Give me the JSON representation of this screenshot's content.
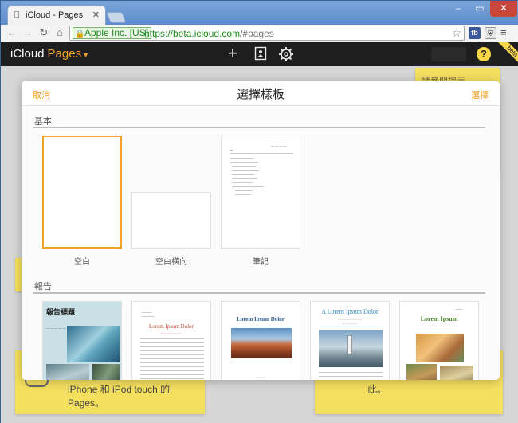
{
  "browser": {
    "tab_title": "iCloud - Pages",
    "ev_label": "Apple Inc. [US]",
    "url_scheme_host": "https://beta.icloud.com",
    "url_path": "/#pages"
  },
  "app": {
    "brand": "iCloud",
    "app_name": "Pages",
    "beta_label": "beta"
  },
  "background": {
    "note_top_right": "請參閱提示",
    "note_bottom_left": "iPhone 和 iPod touch 的 Pages。",
    "note_bottom_right": "此。"
  },
  "dialog": {
    "cancel": "取消",
    "title": "選擇樣板",
    "choose": "選擇",
    "sections": [
      {
        "title": "基本",
        "templates": [
          {
            "name": "空白",
            "selected": true
          },
          {
            "name": "空白橫向",
            "selected": false
          },
          {
            "name": "筆記",
            "selected": false
          }
        ]
      },
      {
        "title": "報告",
        "templates": [
          {
            "title_text": "報告標題"
          },
          {
            "title_text": "Lorem Ipsum Dolor"
          },
          {
            "title_text": "Lorem Ipsum Dolor"
          },
          {
            "title_text": "A Lorem Ipsum Dolor"
          },
          {
            "title_text": "Lorem Ipsum"
          }
        ]
      }
    ]
  },
  "colors": {
    "accent": "#f1a126",
    "sticky": "#f5df5f",
    "appbar": "#1e1e1e"
  }
}
